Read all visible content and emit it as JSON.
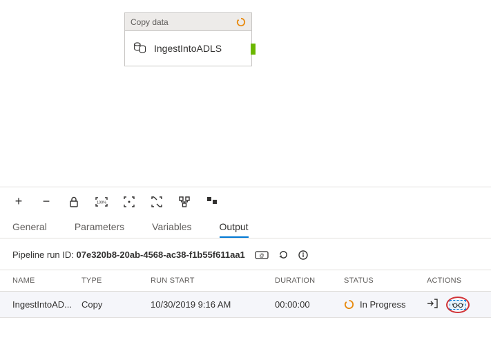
{
  "activity": {
    "type_label": "Copy data",
    "name": "IngestIntoADLS"
  },
  "toolbar": {
    "add": "+",
    "remove": "−"
  },
  "tabs": {
    "general": "General",
    "parameters": "Parameters",
    "variables": "Variables",
    "output": "Output"
  },
  "run": {
    "label": "Pipeline run ID: ",
    "id": "07e320b8-20ab-4568-ac38-f1b55f611aa1"
  },
  "table": {
    "headers": {
      "name": "NAME",
      "type": "TYPE",
      "run_start": "RUN START",
      "duration": "DURATION",
      "status": "STATUS",
      "actions": "ACTIONS"
    },
    "rows": [
      {
        "name": "IngestIntoAD...",
        "type": "Copy",
        "run_start": "10/30/2019 9:16 AM",
        "duration": "00:00:00",
        "status": "In Progress"
      }
    ]
  }
}
